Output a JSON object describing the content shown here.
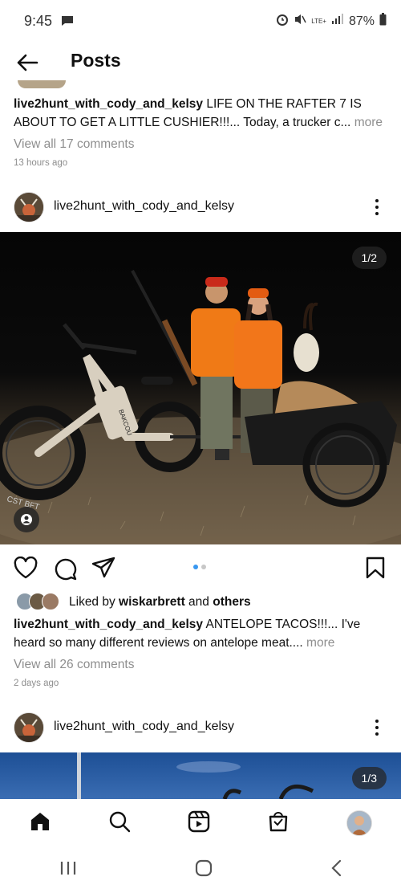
{
  "status_bar": {
    "time": "9:45",
    "battery": "87%",
    "network": "LTE+"
  },
  "header": {
    "title": "Posts"
  },
  "post_prev": {
    "username": "live2hunt_with_cody_and_kelsy",
    "caption": "LIFE ON THE RAFTER 7 IS ABOUT TO GET A LITTLE CUSHIER!!!... Today, a trucker c...",
    "more": "more",
    "comments_link": "View all 17 comments",
    "time_ago": "13 hours ago"
  },
  "post1": {
    "username": "live2hunt_with_cody_and_kelsy",
    "image_counter": "1/2",
    "liked_by_prefix": "Liked by ",
    "liked_by_user": "wiskarbrett",
    "liked_by_and": " and ",
    "liked_by_others": "others",
    "caption_user": "live2hunt_with_cody_and_kelsy",
    "caption": " ANTELOPE TACOS!!!... I've heard so many different reviews on antelope meat....",
    "more": "more",
    "comments_link": "View all 26 comments",
    "time_ago": "2 days ago",
    "carousel_active": 0,
    "carousel_count": 2,
    "bike_brand": "BAKCOU",
    "tire_text": "CST BFT"
  },
  "post2": {
    "username": "live2hunt_with_cody_and_kelsy",
    "image_counter": "1/3"
  },
  "bottom_nav": [
    "home-icon",
    "search-icon",
    "reels-icon",
    "shop-icon",
    "profile-avatar"
  ],
  "sys_nav": [
    "recents-icon",
    "home-circle-icon",
    "back-chevron-icon"
  ],
  "colors": {
    "accent_dot": "#3897f0",
    "inactive_dot": "#c7c7c7"
  }
}
